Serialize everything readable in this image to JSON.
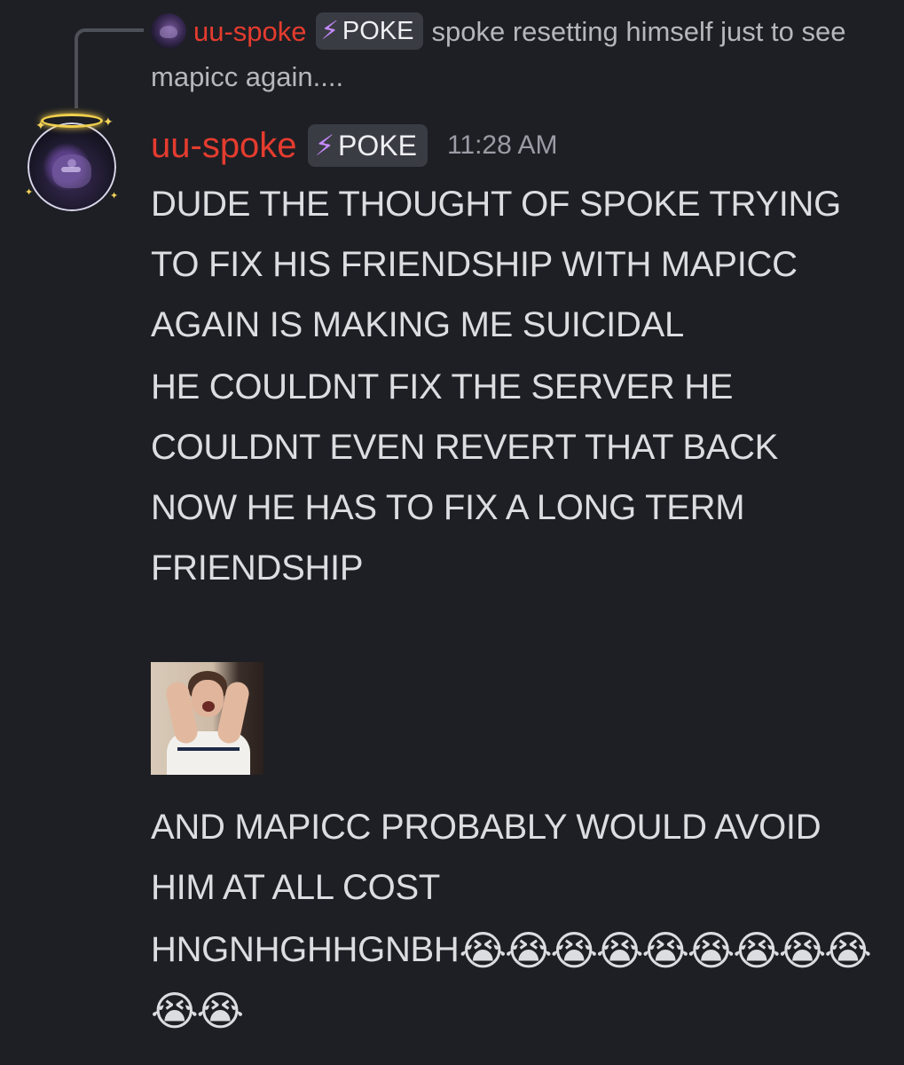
{
  "reply": {
    "username": "uu-spoke",
    "tag_label": "POKE",
    "text": "spoke resetting himself just to see mapicc again...."
  },
  "message": {
    "username": "uu-spoke",
    "tag_label": "POKE",
    "timestamp": "11:28 AM",
    "paragraphs": [
      "DUDE THE THOUGHT OF SPOKE TRYING TO FIX HIS FRIENDSHIP WITH MAPICC AGAIN IS MAKING ME SUICIDAL",
      "HE COULDNT FIX THE SERVER HE COULDNT EVEN REVERT THAT BACK NOW HE HAS TO FIX A LONG TERM FRIENDSHIP"
    ],
    "after_gif": [
      "AND MAPICC PROBABLY WOULD AVOID HIM AT ALL COST"
    ],
    "last_line": "HNGNHGHHGNBH",
    "emoji": "😭",
    "emoji_count": 11
  },
  "icons": {
    "tag_icon": "⚡"
  },
  "colors": {
    "background": "#1e1f24",
    "username": "#e53c2f",
    "tag_bg": "#3a3c44",
    "tag_icon": "#c58af9",
    "text": "#dcdde1",
    "timestamp": "#9a9ca5"
  }
}
